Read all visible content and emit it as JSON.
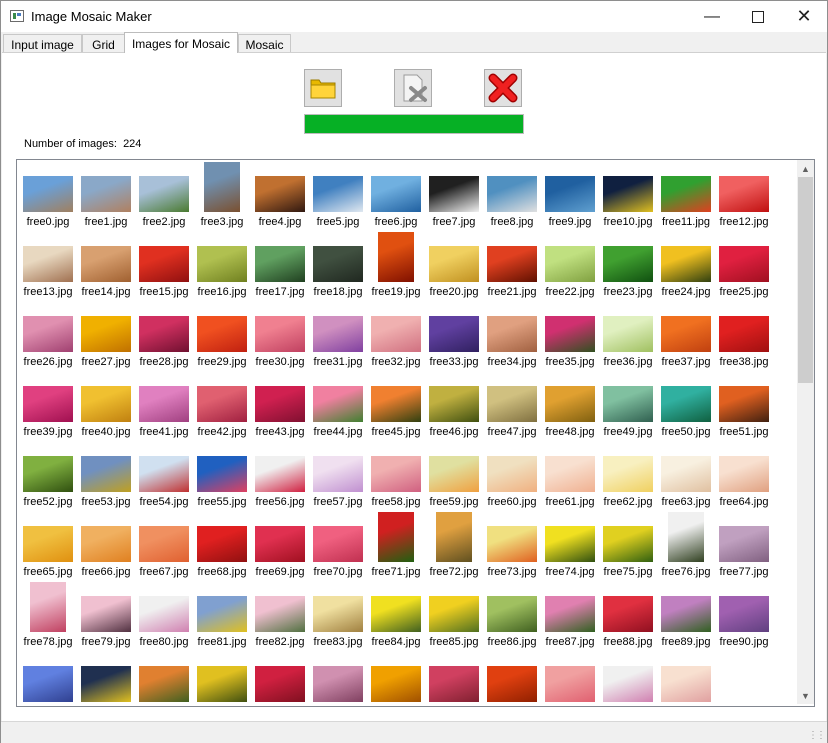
{
  "window": {
    "title": "Image Mosaic Maker"
  },
  "titlebar": {
    "minimize_icon": "minimize-icon",
    "maximize_icon": "maximize-icon",
    "close_icon": "close-icon"
  },
  "tabs": [
    {
      "label": "Input image",
      "active": false
    },
    {
      "label": "Grid",
      "active": false
    },
    {
      "label": "Images for Mosaic",
      "active": true
    },
    {
      "label": "Mosaic",
      "active": false
    }
  ],
  "toolbar": {
    "open_icon": "folder-icon",
    "clear_icon": "delete-file-icon",
    "remove_icon": "red-x-icon"
  },
  "progress": {
    "value": 1.0,
    "color": "#06b025"
  },
  "count": {
    "label": "Number of images:",
    "value": "224"
  },
  "thumbnails": [
    {
      "name": "free0.jpg",
      "colors": [
        "#6aa0d8",
        "#a08060"
      ]
    },
    {
      "name": "free1.jpg",
      "colors": [
        "#8aa8c8",
        "#b08060"
      ]
    },
    {
      "name": "free2.jpg",
      "colors": [
        "#a8c0d8",
        "#4a7a30"
      ]
    },
    {
      "name": "free3.jpg",
      "colors": [
        "#7090b0",
        "#7a5030"
      ],
      "tall": true
    },
    {
      "name": "free4.jpg",
      "colors": [
        "#c07030",
        "#301810"
      ]
    },
    {
      "name": "free5.jpg",
      "colors": [
        "#4080c0",
        "#e0e8f0"
      ]
    },
    {
      "name": "free6.jpg",
      "colors": [
        "#70b0e0",
        "#2060a0"
      ]
    },
    {
      "name": "free7.jpg",
      "colors": [
        "#202020",
        "#f0f0f0"
      ]
    },
    {
      "name": "free8.jpg",
      "colors": [
        "#5090c0",
        "#e0e0e0"
      ]
    },
    {
      "name": "free9.jpg",
      "colors": [
        "#2060a0",
        "#60a0d0"
      ]
    },
    {
      "name": "free10.jpg",
      "colors": [
        "#102040",
        "#e0c020"
      ]
    },
    {
      "name": "free11.jpg",
      "colors": [
        "#30a030",
        "#e04020"
      ]
    },
    {
      "name": "free12.jpg",
      "colors": [
        "#f06060",
        "#c01010"
      ]
    },
    {
      "name": "free13.jpg",
      "colors": [
        "#e8d8c0",
        "#a07050"
      ]
    },
    {
      "name": "free14.jpg",
      "colors": [
        "#d8a070",
        "#a06030"
      ]
    },
    {
      "name": "free15.jpg",
      "colors": [
        "#e03020",
        "#901010"
      ]
    },
    {
      "name": "free16.jpg",
      "colors": [
        "#b0c050",
        "#708020"
      ]
    },
    {
      "name": "free17.jpg",
      "colors": [
        "#60a060",
        "#204020"
      ]
    },
    {
      "name": "free18.jpg",
      "colors": [
        "#405040",
        "#202820"
      ]
    },
    {
      "name": "free19.jpg",
      "colors": [
        "#e05010",
        "#801000"
      ],
      "tall": true
    },
    {
      "name": "free20.jpg",
      "colors": [
        "#f0d060",
        "#c09020"
      ]
    },
    {
      "name": "free21.jpg",
      "colors": [
        "#e04020",
        "#601000"
      ]
    },
    {
      "name": "free22.jpg",
      "colors": [
        "#c0e080",
        "#80a040"
      ]
    },
    {
      "name": "free23.jpg",
      "colors": [
        "#40a030",
        "#105010"
      ]
    },
    {
      "name": "free24.jpg",
      "colors": [
        "#f0c020",
        "#304010"
      ]
    },
    {
      "name": "free25.jpg",
      "colors": [
        "#e02040",
        "#a01020"
      ]
    },
    {
      "name": "free26.jpg",
      "colors": [
        "#e090b0",
        "#a04070"
      ]
    },
    {
      "name": "free27.jpg",
      "colors": [
        "#f0b000",
        "#c07000"
      ]
    },
    {
      "name": "free28.jpg",
      "colors": [
        "#d03060",
        "#701030"
      ]
    },
    {
      "name": "free29.jpg",
      "colors": [
        "#f05020",
        "#c02010"
      ]
    },
    {
      "name": "free30.jpg",
      "colors": [
        "#f08090",
        "#c04060"
      ]
    },
    {
      "name": "free31.jpg",
      "colors": [
        "#d090c0",
        "#8040a0"
      ]
    },
    {
      "name": "free32.jpg",
      "colors": [
        "#f0b0b0",
        "#d07080"
      ]
    },
    {
      "name": "free33.jpg",
      "colors": [
        "#6040a0",
        "#302060"
      ]
    },
    {
      "name": "free34.jpg",
      "colors": [
        "#e0a080",
        "#a06040"
      ]
    },
    {
      "name": "free35.jpg",
      "colors": [
        "#d03070",
        "#305020"
      ]
    },
    {
      "name": "free36.jpg",
      "colors": [
        "#e0f0c0",
        "#a0c060"
      ]
    },
    {
      "name": "free37.jpg",
      "colors": [
        "#f07020",
        "#c04010"
      ]
    },
    {
      "name": "free38.jpg",
      "colors": [
        "#e02020",
        "#a01010"
      ]
    },
    {
      "name": "free39.jpg",
      "colors": [
        "#e04080",
        "#a01050"
      ]
    },
    {
      "name": "free40.jpg",
      "colors": [
        "#f0c030",
        "#c08010"
      ]
    },
    {
      "name": "free41.jpg",
      "colors": [
        "#e080c0",
        "#a04080"
      ]
    },
    {
      "name": "free42.jpg",
      "colors": [
        "#e06070",
        "#a02040"
      ]
    },
    {
      "name": "free43.jpg",
      "colors": [
        "#d02050",
        "#801030"
      ]
    },
    {
      "name": "free44.jpg",
      "colors": [
        "#f080a0",
        "#408030"
      ]
    },
    {
      "name": "free45.jpg",
      "colors": [
        "#f08030",
        "#304010"
      ]
    },
    {
      "name": "free46.jpg",
      "colors": [
        "#c0b040",
        "#405010"
      ]
    },
    {
      "name": "free47.jpg",
      "colors": [
        "#d0c080",
        "#807040"
      ]
    },
    {
      "name": "free48.jpg",
      "colors": [
        "#e0a030",
        "#806010"
      ]
    },
    {
      "name": "free49.jpg",
      "colors": [
        "#80c0a0",
        "#306050"
      ]
    },
    {
      "name": "free50.jpg",
      "colors": [
        "#30b0a0",
        "#106040"
      ]
    },
    {
      "name": "free51.jpg",
      "colors": [
        "#e06020",
        "#402010"
      ]
    },
    {
      "name": "free52.jpg",
      "colors": [
        "#80b040",
        "#305010"
      ]
    },
    {
      "name": "free53.jpg",
      "colors": [
        "#7090c0",
        "#c0a020"
      ]
    },
    {
      "name": "free54.jpg",
      "colors": [
        "#d0e0f0",
        "#c03030"
      ]
    },
    {
      "name": "free55.jpg",
      "colors": [
        "#2060c0",
        "#e04060"
      ]
    },
    {
      "name": "free56.jpg",
      "colors": [
        "#f0f0f0",
        "#d02040"
      ]
    },
    {
      "name": "free57.jpg",
      "colors": [
        "#f0e0f0",
        "#c090d0"
      ]
    },
    {
      "name": "free58.jpg",
      "colors": [
        "#f0b0b0",
        "#d06080"
      ]
    },
    {
      "name": "free59.jpg",
      "colors": [
        "#e0e0a0",
        "#f0a040"
      ]
    },
    {
      "name": "free60.jpg",
      "colors": [
        "#f0e0c0",
        "#f0b080"
      ]
    },
    {
      "name": "free61.jpg",
      "colors": [
        "#f8e0d0",
        "#f0b090"
      ]
    },
    {
      "name": "free62.jpg",
      "colors": [
        "#f8f0c0",
        "#f0d060"
      ]
    },
    {
      "name": "free63.jpg",
      "colors": [
        "#f8f0e0",
        "#e0c0a0"
      ]
    },
    {
      "name": "free64.jpg",
      "colors": [
        "#f8e0d0",
        "#e0a080"
      ]
    },
    {
      "name": "free65.jpg",
      "colors": [
        "#f0c040",
        "#e09010"
      ]
    },
    {
      "name": "free66.jpg",
      "colors": [
        "#f0b060",
        "#e08020"
      ]
    },
    {
      "name": "free67.jpg",
      "colors": [
        "#f09060",
        "#e06030"
      ]
    },
    {
      "name": "free68.jpg",
      "colors": [
        "#e02020",
        "#901010"
      ]
    },
    {
      "name": "free69.jpg",
      "colors": [
        "#e03050",
        "#a01020"
      ]
    },
    {
      "name": "free70.jpg",
      "colors": [
        "#f06080",
        "#c03050"
      ]
    },
    {
      "name": "free71.jpg",
      "colors": [
        "#d02020",
        "#206010"
      ],
      "tall": true
    },
    {
      "name": "free72.jpg",
      "colors": [
        "#e0a040",
        "#605020"
      ],
      "tall": true
    },
    {
      "name": "free73.jpg",
      "colors": [
        "#f0e080",
        "#e06020"
      ]
    },
    {
      "name": "free74.jpg",
      "colors": [
        "#f0e020",
        "#305010"
      ]
    },
    {
      "name": "free75.jpg",
      "colors": [
        "#e0d020",
        "#306010"
      ]
    },
    {
      "name": "free76.jpg",
      "colors": [
        "#f0f0f0",
        "#304020"
      ],
      "tall": true
    },
    {
      "name": "free77.jpg",
      "colors": [
        "#c0a0c0",
        "#806080"
      ]
    },
    {
      "name": "free78.jpg",
      "colors": [
        "#f0c0d0",
        "#c04060"
      ],
      "tall": true
    },
    {
      "name": "free79.jpg",
      "colors": [
        "#f0c0d0",
        "#503040"
      ]
    },
    {
      "name": "free80.jpg",
      "colors": [
        "#f0f0f0",
        "#d080b0"
      ]
    },
    {
      "name": "free81.jpg",
      "colors": [
        "#80a0d0",
        "#e0c020"
      ]
    },
    {
      "name": "free82.jpg",
      "colors": [
        "#f0c0d0",
        "#507040"
      ]
    },
    {
      "name": "free83.jpg",
      "colors": [
        "#f0e0a0",
        "#a08040"
      ]
    },
    {
      "name": "free84.jpg",
      "colors": [
        "#f0e020",
        "#406020"
      ]
    },
    {
      "name": "free85.jpg",
      "colors": [
        "#f0d020",
        "#507020"
      ]
    },
    {
      "name": "free86.jpg",
      "colors": [
        "#a0c060",
        "#406020"
      ]
    },
    {
      "name": "free87.jpg",
      "colors": [
        "#e080b0",
        "#306020"
      ]
    },
    {
      "name": "free88.jpg",
      "colors": [
        "#e03040",
        "#901020"
      ]
    },
    {
      "name": "free89.jpg",
      "colors": [
        "#c080c0",
        "#306020"
      ]
    },
    {
      "name": "free90.jpg",
      "colors": [
        "#a060b0",
        "#604080"
      ]
    },
    {
      "name": "",
      "colors": [
        "#6080e0",
        "#304090"
      ]
    },
    {
      "name": "",
      "colors": [
        "#203050",
        "#e0c020"
      ]
    },
    {
      "name": "",
      "colors": [
        "#e08030",
        "#406020"
      ]
    },
    {
      "name": "",
      "colors": [
        "#e0c020",
        "#405010"
      ]
    },
    {
      "name": "",
      "colors": [
        "#d02040",
        "#801020"
      ]
    },
    {
      "name": "",
      "colors": [
        "#d090b0",
        "#804060"
      ]
    },
    {
      "name": "",
      "colors": [
        "#f0a000",
        "#a05000"
      ]
    },
    {
      "name": "",
      "colors": [
        "#d04060",
        "#802030"
      ]
    },
    {
      "name": "",
      "colors": [
        "#e04010",
        "#902000"
      ]
    },
    {
      "name": "",
      "colors": [
        "#f0a0a0",
        "#e06070"
      ]
    },
    {
      "name": "",
      "colors": [
        "#f0f0f0",
        "#d080b0"
      ]
    },
    {
      "name": "",
      "colors": [
        "#f8e0d0",
        "#e0a0a0"
      ]
    }
  ]
}
